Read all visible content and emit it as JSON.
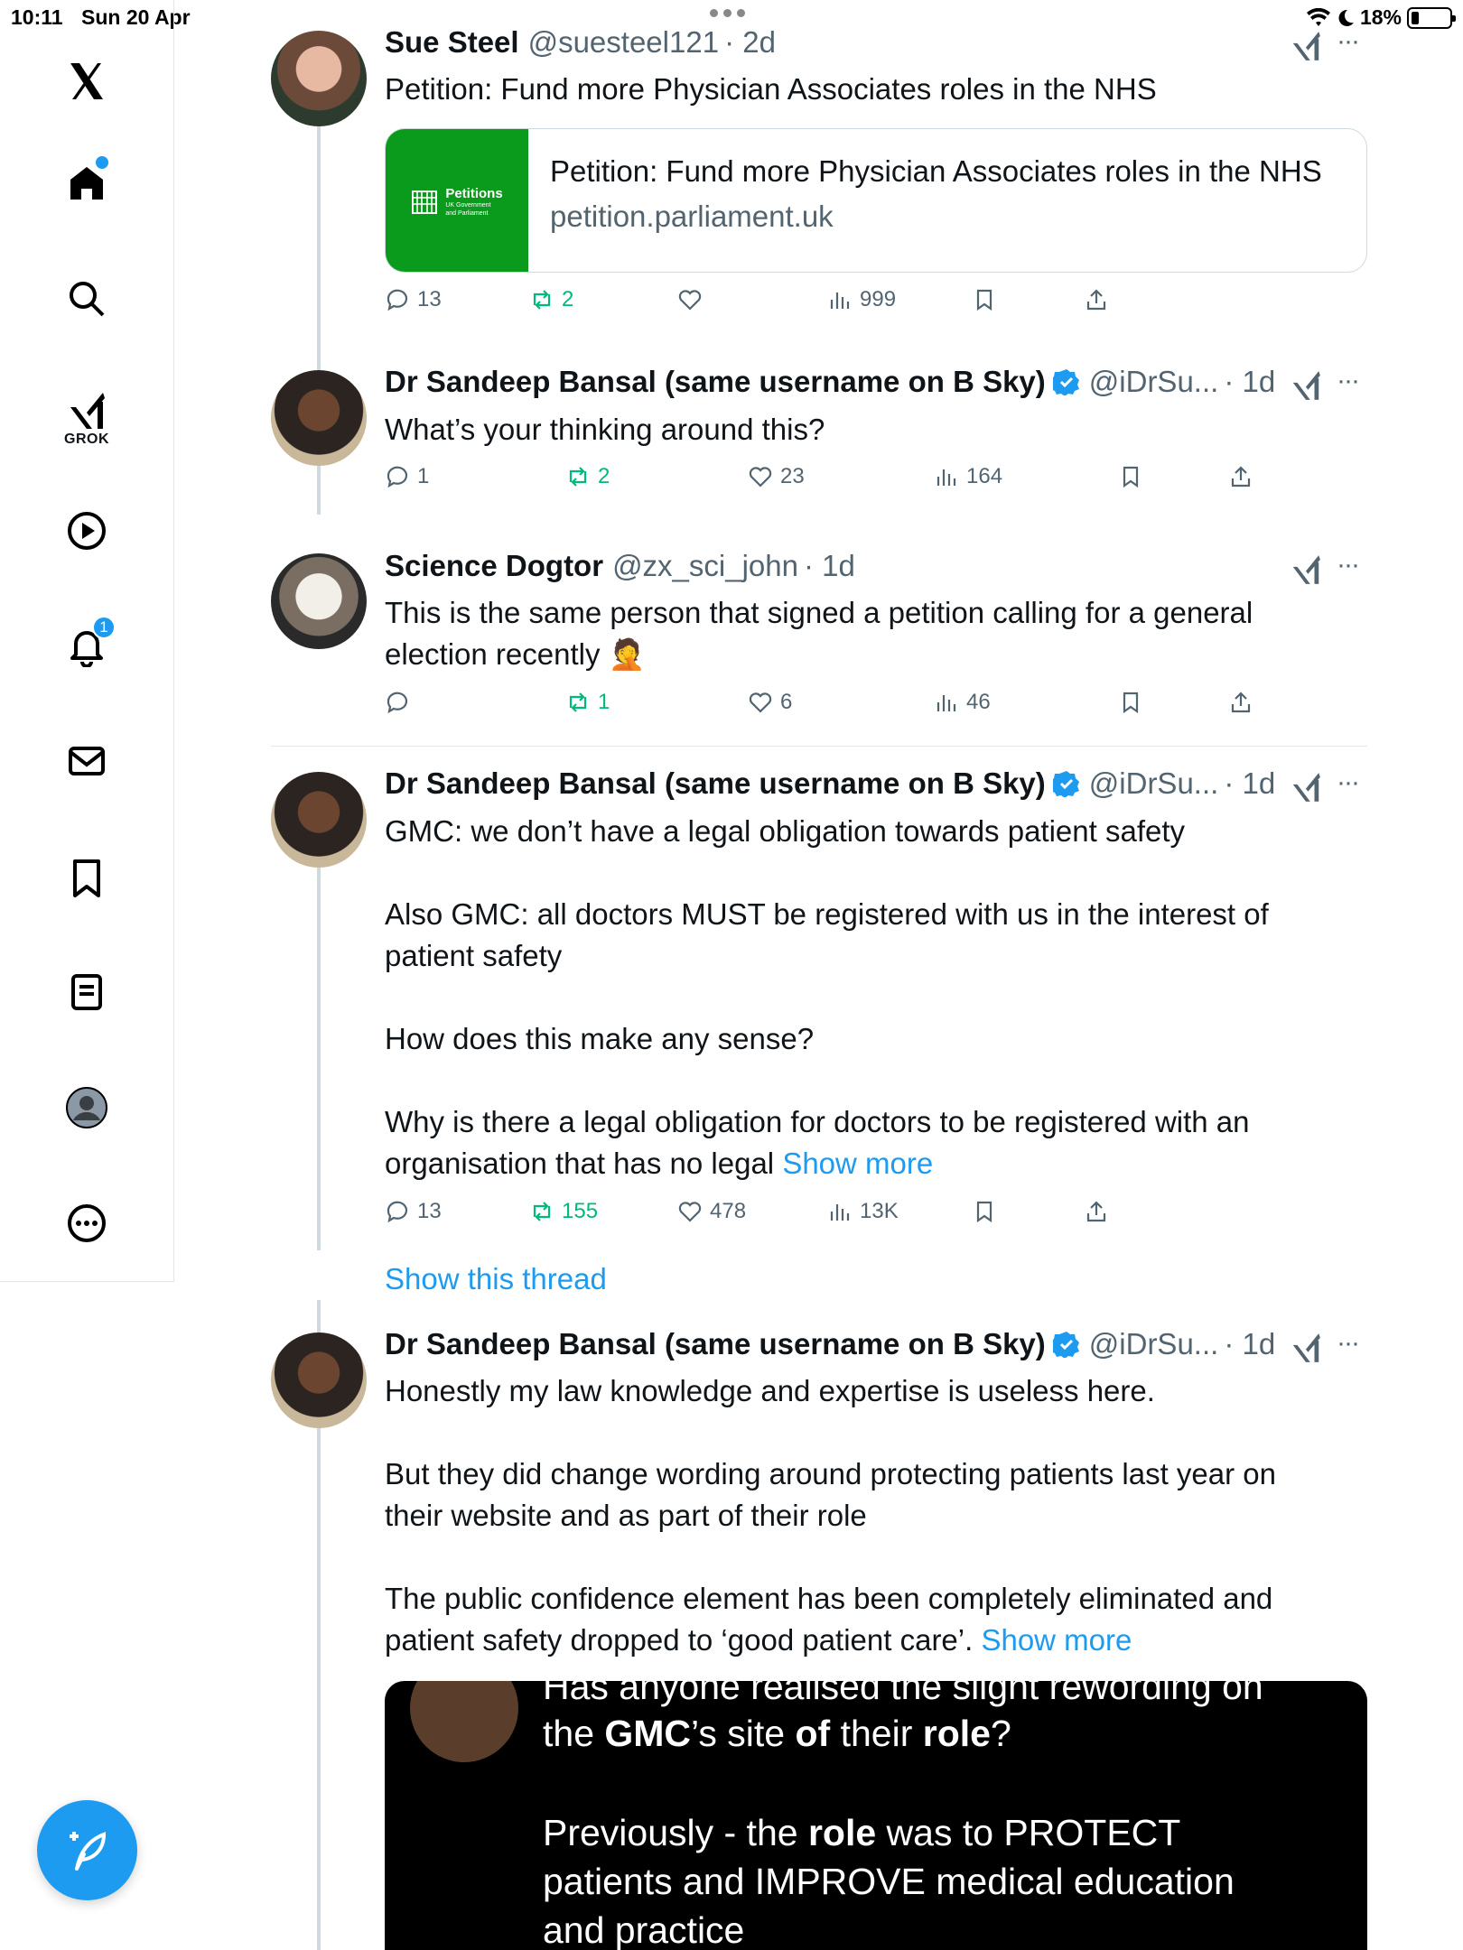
{
  "status_bar": {
    "time": "10:11",
    "date": "Sun 20 Apr",
    "battery": "18%"
  },
  "sidebar": {
    "grok_label": "GROK",
    "notifications_count": "1",
    "items": [
      "home",
      "explore",
      "grok",
      "videos",
      "notifications",
      "messages",
      "bookmarks",
      "lists",
      "profile",
      "more"
    ]
  },
  "posts": [
    {
      "name": "Sue Steel",
      "handle": "@suesteel121",
      "time": "· 2d",
      "text": "Petition: Fund more Physician Associates roles in the NHS",
      "card": {
        "thumb_title": "Petitions",
        "thumb_sub": "UK Government and Parliament",
        "title": "Petition: Fund more Physician Associates roles in the NHS",
        "domain": "petition.parliament.uk"
      },
      "replies": "13",
      "retweets": "2",
      "likes": "",
      "views": "999"
    },
    {
      "name": "Dr Sandeep Bansal (same username on B Sky)",
      "handle": "@iDrSu...",
      "time": "· 1d",
      "text": "What’s your thinking around this?",
      "replies": "1",
      "retweets": "2",
      "likes": "23",
      "views": "164"
    },
    {
      "name": "Science Dogtor",
      "handle": "@zx_sci_john",
      "time": "· 1d",
      "text": "This is the same person that signed a petition calling for a general\nelection recently 🤦",
      "replies": "",
      "retweets": "1",
      "likes": "6",
      "views": "46"
    },
    {
      "name": "Dr Sandeep Bansal (same username on B Sky)",
      "handle": "@iDrSu...",
      "time": "· 1d",
      "text": "GMC: we don’t have a legal obligation towards patient safety\n\nAlso GMC: all doctors MUST be registered with us in the interest of\npatient safety\n\nHow does this make any sense?\n\nWhy is there a legal obligation for doctors to be registered with an\norganisation that has no legal ",
      "show_more": "Show more",
      "replies": "13",
      "retweets": "155",
      "likes": "478",
      "views": "13K"
    },
    {
      "name": "Dr Sandeep Bansal (same username on B Sky)",
      "handle": "@iDrSu...",
      "time": "· 1d",
      "text": "Honestly my law knowledge and expertise is useless here.\n\nBut they did change wording around protecting patients last year on\ntheir website and as part of their role\n\nThe public confidence element has been completely eliminated and\npatient safety dropped to ‘good patient care’. ",
      "show_more": "Show more"
    }
  ],
  "show_thread": "Show this thread",
  "quote_image": {
    "line0": "Has anyone realised the slight rewording on",
    "line1_a": "the ",
    "line1_b": "GMC",
    "line1_c": "’s site ",
    "line1_d": "of",
    "line1_e": " their ",
    "line1_f": "role",
    "line1_g": "?",
    "line2_a": "Previously - the ",
    "line2_b": "role",
    "line2_c": " was to PROTECT",
    "line3": "patients and IMPROVE medical education",
    "line4": "and practice"
  },
  "colors": {
    "accent": "#1d9bf0",
    "retweet": "#00ba7c",
    "petition_green": "#0a9b1c",
    "muted": "#536471"
  }
}
